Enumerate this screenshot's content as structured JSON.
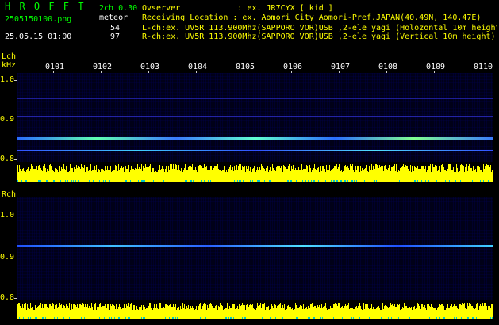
{
  "header": {
    "title": "H R O F F T",
    "version": "2ch 0.30",
    "filename": "2505150100.png",
    "datetime": "25.05.15 01:00",
    "mode": "meteor",
    "lch_count": "54",
    "rch_count": "97",
    "observer_line": "Ovserver            : ex. JR7CYX [ kid ]",
    "location_line": "Receiving Location : ex. Aomori City Aomori-Pref.JAPAN(40.49N, 140.47E)",
    "lch_line": "L-ch:ex. UV5R 113.900Mhz(SAPPORO VOR)USB ,2-ele yagi (Holozontal 10m height)",
    "rch_line": "R-ch:ex. UV5R 113.900Mhz(SAPPORO VOR)USB ,2-ele yagi (Vertical 10m height)"
  },
  "lch": {
    "label": "Lch",
    "unit": "kHz",
    "ticks": [
      "1.0",
      "0.9",
      "0.8"
    ]
  },
  "rch": {
    "label": "Rch",
    "ticks": [
      "1.0",
      "0.9",
      "0.8"
    ]
  },
  "time_labels": [
    "0101",
    "0102",
    "0103",
    "0104",
    "0105",
    "0106",
    "0107",
    "0108",
    "0109",
    "0110"
  ],
  "colors": {
    "text_green": "#00ff00",
    "text_yellow": "#ffff00",
    "bars": "#ffff00",
    "bar_base": "#00c8c8"
  }
}
